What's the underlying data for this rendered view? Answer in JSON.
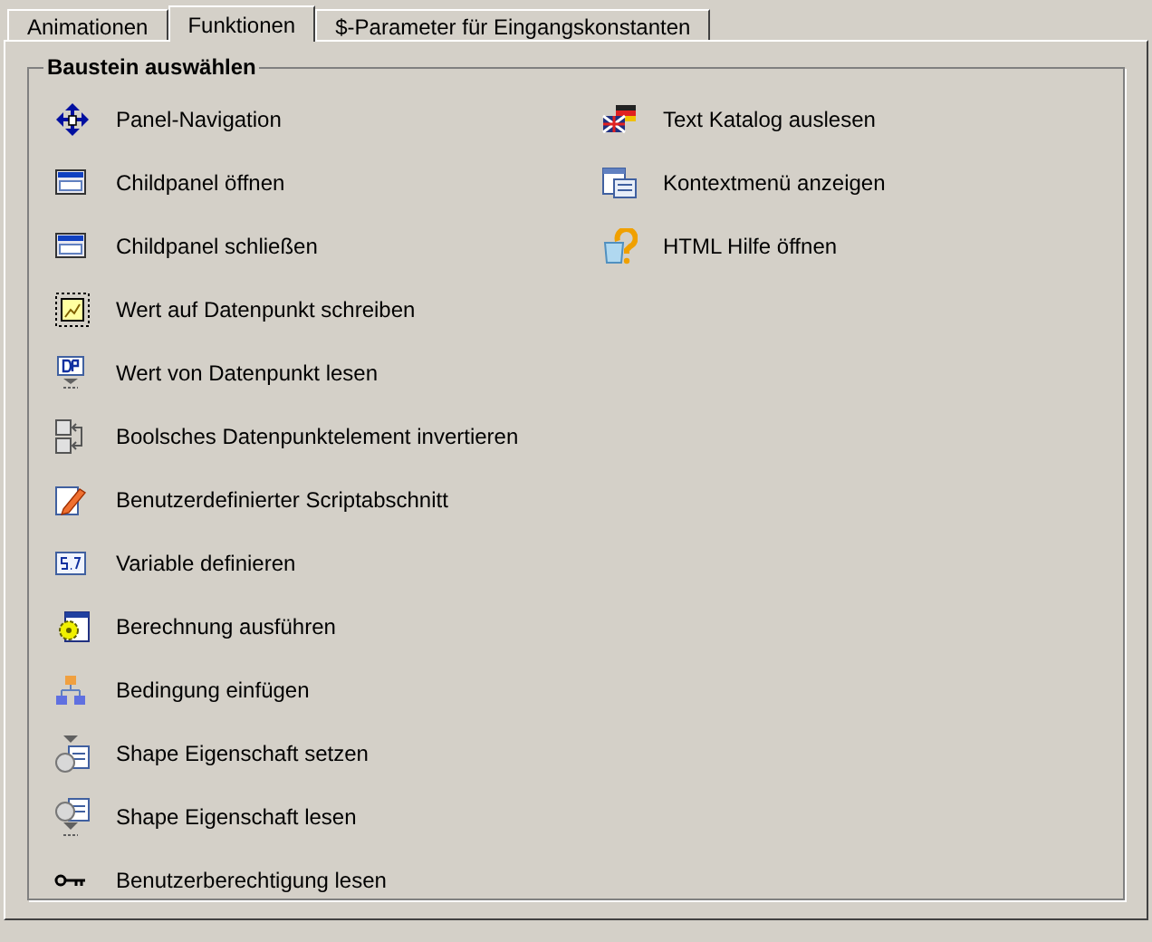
{
  "tabs": [
    {
      "label": "Animationen",
      "selected": false
    },
    {
      "label": "Funktionen",
      "selected": true
    },
    {
      "label": "$-Parameter für Eingangskonstanten",
      "selected": false
    }
  ],
  "group": {
    "title": "Baustein auswählen",
    "columns": [
      [
        {
          "label": "Panel-Navigation",
          "kind": "nav"
        },
        {
          "label": "Childpanel öffnen",
          "kind": "window"
        },
        {
          "label": "Childpanel schließen",
          "kind": "window"
        },
        {
          "label": "Wert auf Datenpunkt schreiben",
          "kind": "write"
        },
        {
          "label": "Wert von Datenpunkt lesen",
          "kind": "dp"
        },
        {
          "label": "Boolsches Datenpunktelement invertieren",
          "kind": "bool"
        },
        {
          "label": "Benutzerdefinierter Scriptabschnitt",
          "kind": "script"
        },
        {
          "label": "Variable definieren",
          "kind": "variable"
        },
        {
          "label": "Berechnung ausführen",
          "kind": "calc"
        },
        {
          "label": "Bedingung einfügen",
          "kind": "condition"
        },
        {
          "label": "Shape Eigenschaft setzen",
          "kind": "shape_set"
        },
        {
          "label": "Shape Eigenschaft lesen",
          "kind": "shape_get"
        },
        {
          "label": "Benutzerberechtigung lesen",
          "kind": "key"
        }
      ],
      [
        {
          "label": "Text Katalog auslesen",
          "kind": "catalog"
        },
        {
          "label": "Kontextmenü anzeigen",
          "kind": "context"
        },
        {
          "label": "HTML Hilfe öffnen",
          "kind": "help"
        }
      ]
    ]
  }
}
